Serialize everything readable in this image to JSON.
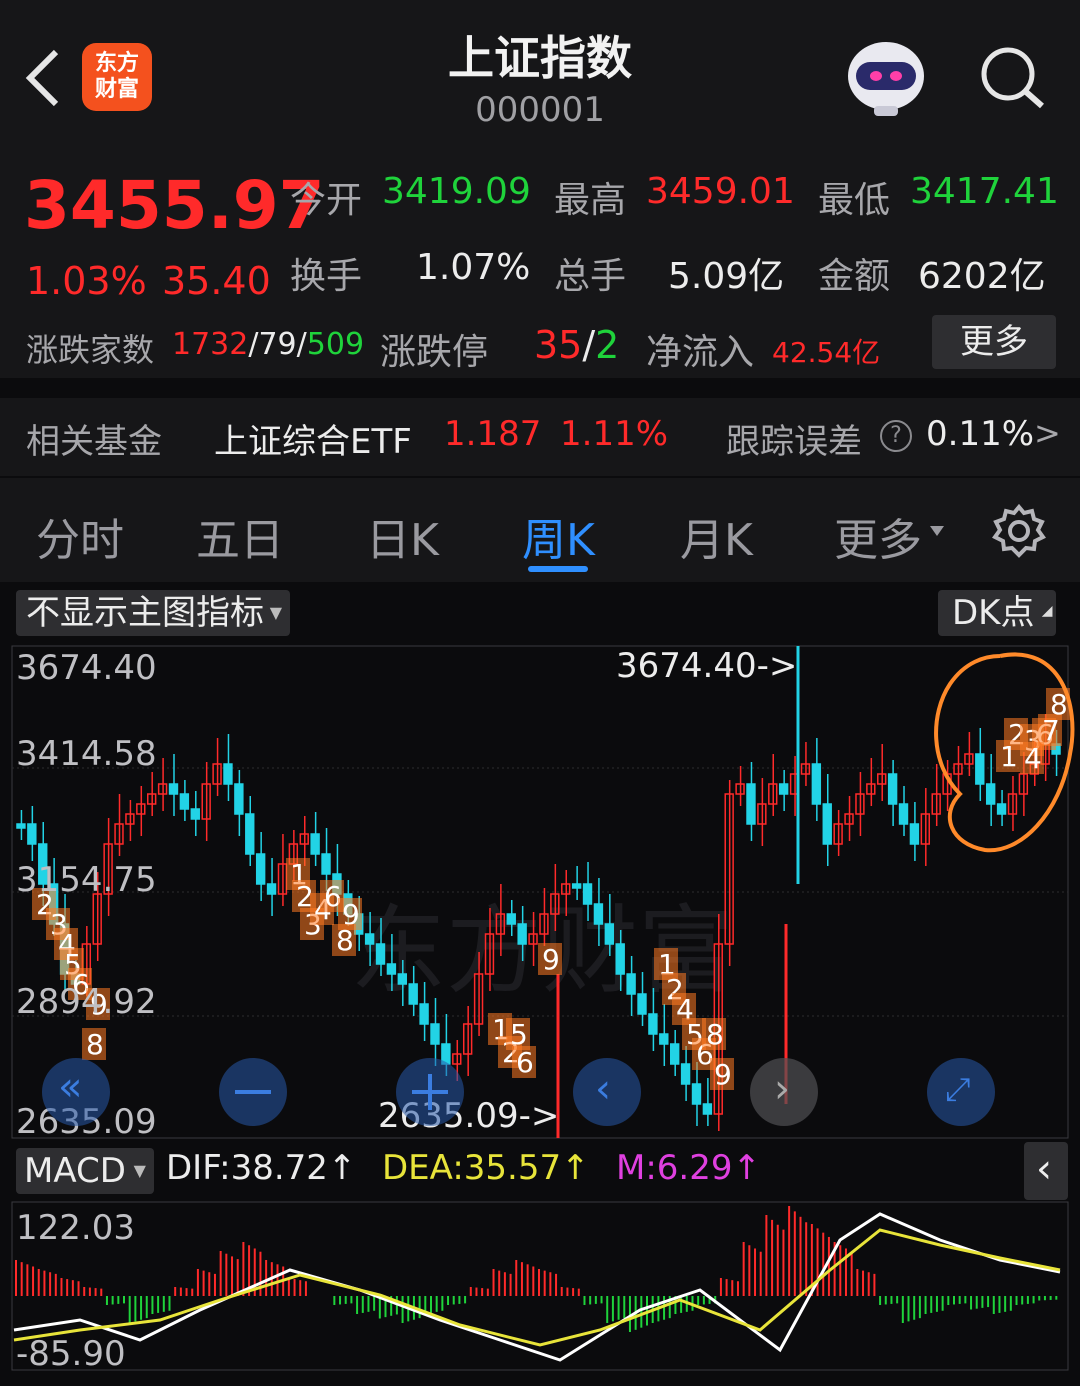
{
  "header": {
    "title": "上证指数",
    "code": "000001",
    "logo_line1": "东方",
    "logo_line2": "财富"
  },
  "quote": {
    "price": "3455.97",
    "change_pct": "1.03%",
    "change_amt": "35.40",
    "open_label": "今开",
    "open_value": "3419.09",
    "high_label": "最高",
    "high_value": "3459.01",
    "low_label": "最低",
    "low_value": "3417.41",
    "turnover_label": "换手",
    "turnover_value": "1.07%",
    "volume_label": "总手",
    "volume_value": "5.09亿",
    "amount_label": "金额",
    "amount_value": "6202亿",
    "breadth_label": "涨跌家数",
    "breadth_up": "1732",
    "breadth_sep1": "/",
    "breadth_flat": "79",
    "breadth_sep2": "/",
    "breadth_down": "509",
    "limit_label": "涨跌停",
    "limit_up": "35",
    "limit_sep": "/",
    "limit_down": "2",
    "netflow_label": "净流入",
    "netflow_value": "42.54亿",
    "more_button": "更多"
  },
  "fund": {
    "label": "相关基金",
    "name": "上证综合ETF",
    "price": "1.187",
    "pct": "1.11%",
    "tracking_label": "跟踪误差",
    "tracking_value": "0.11%",
    "arrow": ">"
  },
  "tabs": [
    {
      "label": "分时",
      "active": false
    },
    {
      "label": "五日",
      "active": false
    },
    {
      "label": "日K",
      "active": false
    },
    {
      "label": "周K",
      "active": true
    },
    {
      "label": "月K",
      "active": false
    },
    {
      "label": "更多",
      "active": false
    }
  ],
  "chart": {
    "indicator_select": "不显示主图指标",
    "dk_select": "DK点",
    "y_labels": [
      "3674.40",
      "3414.58",
      "3154.75",
      "2894.92",
      "2635.09"
    ],
    "max_marker": "3674.40->",
    "min_marker": "2635.09->",
    "watermark": "东方财富"
  },
  "macd": {
    "select": "MACD",
    "dif": "DIF:38.72↑",
    "dea": "DEA:35.57↑",
    "m": "M:6.29↑",
    "y_top": "122.03",
    "y_bottom": "-85.90"
  },
  "colors": {
    "up": "#ff2a2a",
    "down": "#22d3e6",
    "accent": "#2f8fff",
    "dea": "#e8e43a",
    "m": "#e040e0",
    "annotation": "#ff7a22"
  },
  "icons": {
    "back": "chevron-left-icon",
    "search": "search-icon",
    "settings": "gear-icon",
    "avatar": "robot-avatar-icon"
  }
}
